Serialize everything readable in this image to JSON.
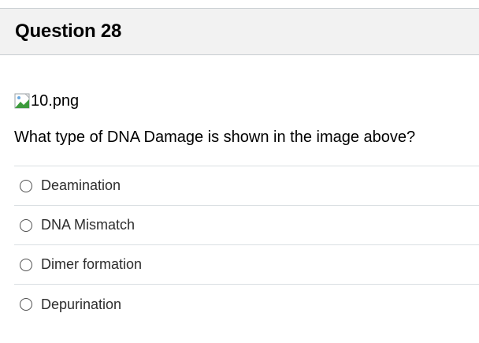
{
  "question": {
    "title": "Question 28",
    "image_alt": "10.png",
    "text": "What type of DNA Damage is shown in the image above?",
    "answers": [
      {
        "label": "Deamination"
      },
      {
        "label": "DNA Mismatch"
      },
      {
        "label": "Dimer formation"
      },
      {
        "label": "Depurination"
      }
    ]
  },
  "colors": {
    "header_bg": "#f2f2f2",
    "divider": "#dadfe2",
    "text": "#000000"
  },
  "icons": {
    "broken_image": "broken-image-icon",
    "radio": "radio-unchecked-icon"
  }
}
